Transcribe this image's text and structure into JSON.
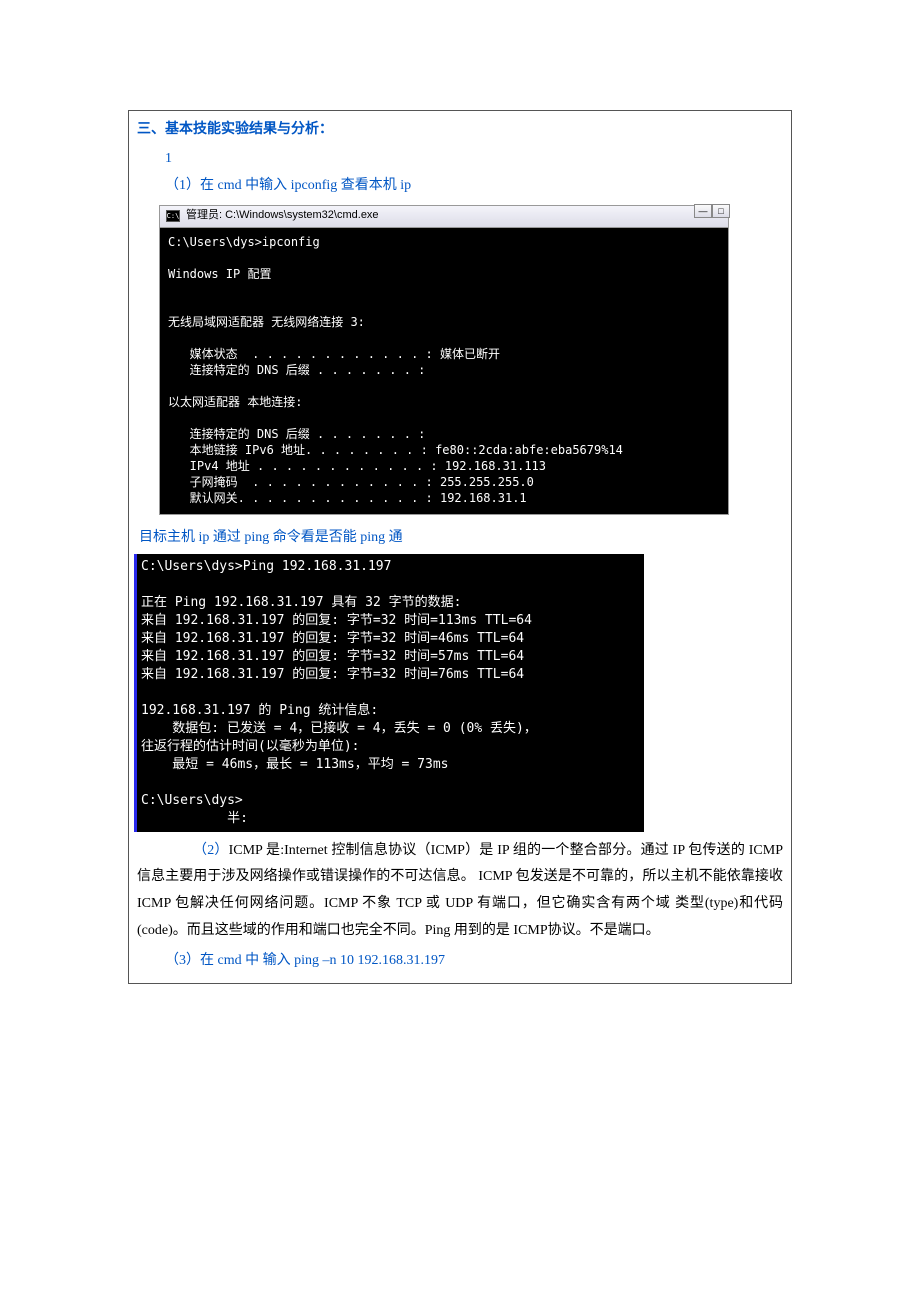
{
  "section_title": "三、基本技能实验结果与分析：",
  "item1_num": "1",
  "step1": "（1）在 cmd 中输入 ipconfig 查看本机 ip",
  "term1": {
    "title": "管理员: C:\\Windows\\system32\\cmd.exe",
    "icon_text": "C:\\",
    "body": "C:\\Users\\dys>ipconfig\n\nWindows IP 配置\n\n\n无线局域网适配器 无线网络连接 3:\n\n   媒体状态  . . . . . . . . . . . . : 媒体已断开\n   连接特定的 DNS 后缀 . . . . . . . :\n\n以太网适配器 本地连接:\n\n   连接特定的 DNS 后缀 . . . . . . . :\n   本地链接 IPv6 地址. . . . . . . . : fe80::2cda:abfe:eba5679%14\n   IPv4 地址 . . . . . . . . . . . . : 192.168.31.113\n   子网掩码  . . . . . . . . . . . . : 255.255.255.0\n   默认网关. . . . . . . . . . . . . : 192.168.31.1"
  },
  "ping_caption": "目标主机 ip 通过 ping 命令看是否能 ping 通",
  "term2_body": "C:\\Users\\dys>Ping 192.168.31.197\n\n正在 Ping 192.168.31.197 具有 32 字节的数据:\n来自 192.168.31.197 的回复: 字节=32 时间=113ms TTL=64\n来自 192.168.31.197 的回复: 字节=32 时间=46ms TTL=64\n来自 192.168.31.197 的回复: 字节=32 时间=57ms TTL=64\n来自 192.168.31.197 的回复: 字节=32 时间=76ms TTL=64\n\n192.168.31.197 的 Ping 统计信息:\n    数据包: 已发送 = 4，已接收 = 4，丢失 = 0 (0% 丢失)，\n往返行程的估计时间(以毫秒为单位):\n    最短 = 46ms，最长 = 113ms，平均 = 73ms\n\nC:\\Users\\dys>\n           半:",
  "para2_prefix": "（2）",
  "para2_body": "ICMP 是:Internet 控制信息协议（ICMP）是 IP 组的一个整合部分。通过 IP 包传送的 ICMP 信息主要用于涉及网络操作或错误操作的不可达信息。 ICMP 包发送是不可靠的，所以主机不能依靠接收 ICMP 包解决任何网络问题。ICMP 不象 TCP 或 UDP 有端口，但它确实含有两个域 类型(type)和代码(code)。而且这些域的作用和端口也完全不同。Ping 用到的是 ICMP协议。不是端口。",
  "step3_prefix": "（3）",
  "step3_body": "在 cmd 中 输入 ping –n 10 192.168.31.197"
}
